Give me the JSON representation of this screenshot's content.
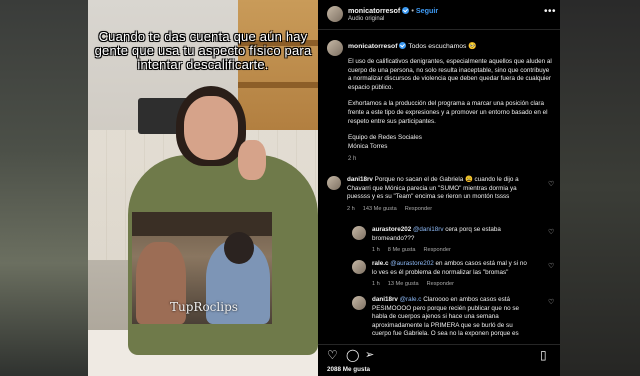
{
  "video": {
    "caption": "Cuando te das cuenta que aún hay gente que usa tu aspecto físico para intentar descalificarte.",
    "watermark": "TupRoclips"
  },
  "header": {
    "username": "monicatorresof",
    "follow_label": "Seguir",
    "subtitle": "Audio original",
    "more_icon": "more-horizontal-icon"
  },
  "post": {
    "username": "monicatorresof",
    "greeting": "Todos escuchamos",
    "greeting_emoji": "🥺",
    "paragraph1": "El uso de calificativos denigrantes, especialmente aquellos que aluden al cuerpo de una persona, no solo resulta inaceptable, sino que contribuye a normalizar discursos de violencia que deben quedar fuera de cualquier espacio público.",
    "paragraph2": "Exhortamos a la producción del programa a marcar una posición clara frente a este tipo de expresiones y a promover un entorno basado en el respeto entre sus participantes.",
    "signature1": "Equipo de Redes Sociales",
    "signature2": "Mónica Torres",
    "time": "2 h"
  },
  "comments": [
    {
      "user": "dani18rv",
      "lines": [
        "Porque no sacan el de Gabriela 😩 cuando le dijo a",
        "Chavarri que Mónica parecia un \"SUMO\" mientras dormia ya",
        "puessss y es su \"Team\" encima se rieron un montón tssss"
      ],
      "time": "2 h",
      "likes": "143 Me gusta",
      "reply": "Responder"
    },
    {
      "user": "aurastore202",
      "mention": "@dani18rv",
      "lines_rest": " cera porq se estaba",
      "lines": [
        "bromeando???"
      ],
      "time": "1 h",
      "likes": "8 Me gusta",
      "reply": "Responder"
    },
    {
      "user": "rale.c",
      "mention": "@aurastore202",
      "lines_rest": " en ambos casos está mal y si no",
      "lines": [
        "lo ves es él problema de normalizar las \"bromas\""
      ],
      "time": "1 h",
      "likes": "13 Me gusta",
      "reply": "Responder"
    },
    {
      "user": "dani18rv",
      "mention": "@rale.c",
      "lines_rest": " Claroooo en ambos casos está",
      "lines": [
        "PESIMOOOO pero porque recién publicar que no se",
        "habla de cuerpos ajenos si hace una semana",
        "aproximadamente la PRIMERA que se burló de su",
        "cuerpo fue Gabriela. O sea no la exponen porque es"
      ]
    }
  ],
  "actions": {
    "like_icon": "heart-icon",
    "comment_icon": "comment-icon",
    "share_icon": "send-icon",
    "save_icon": "bookmark-icon",
    "likes_count": "2088 Me gusta"
  }
}
